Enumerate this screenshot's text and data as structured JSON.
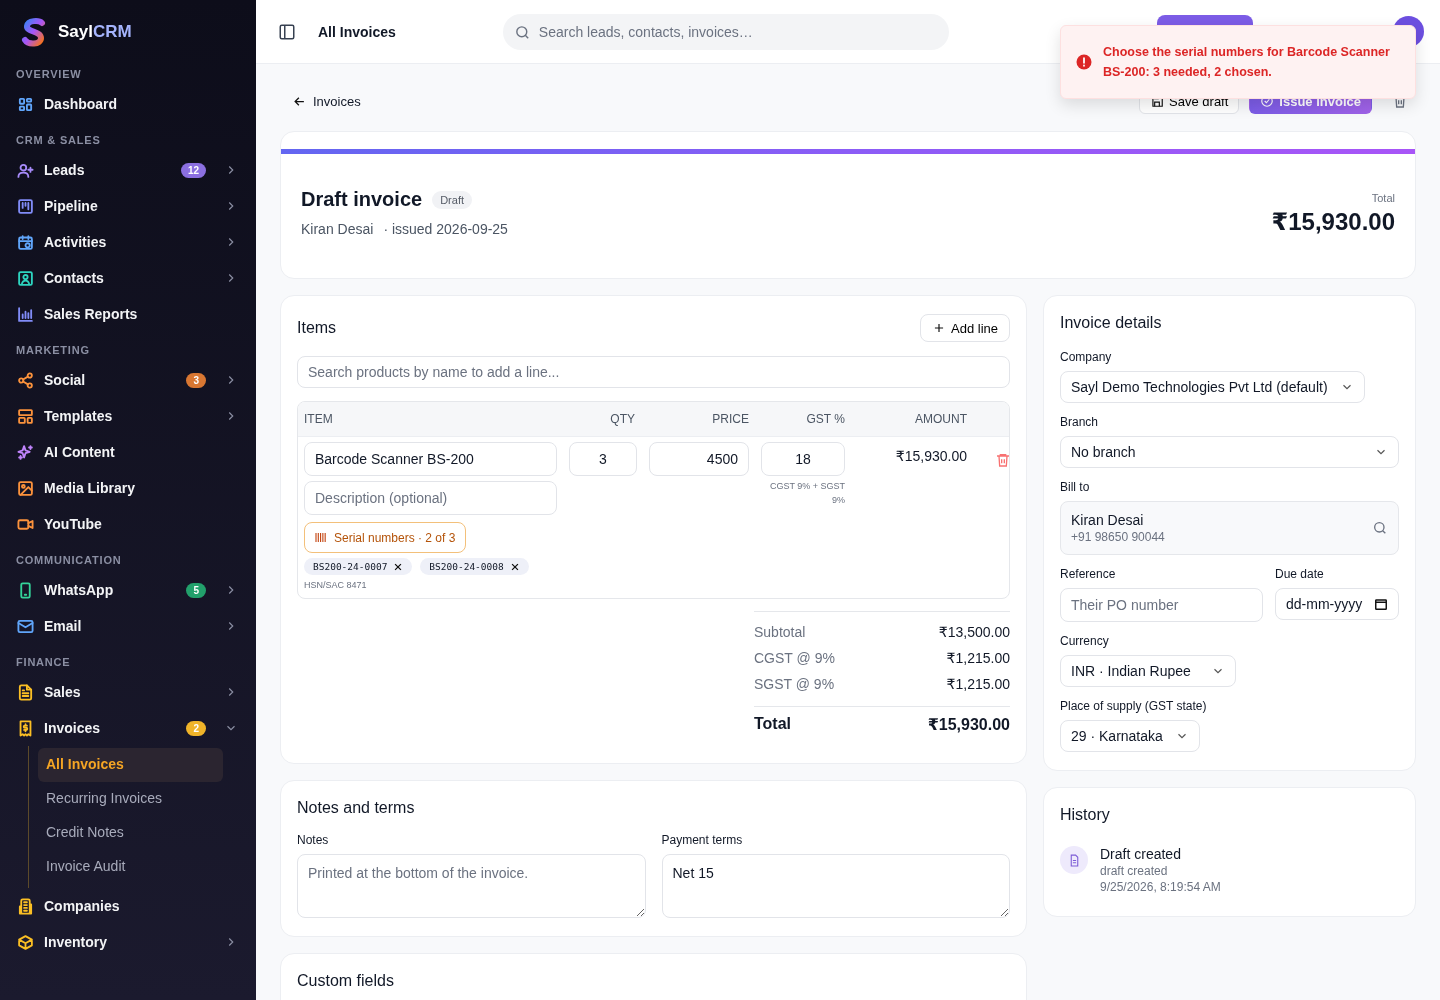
{
  "sidebar": {
    "brand": {
      "first": "Sayl",
      "second": "CRM"
    },
    "sections": [
      {
        "title": "OVERVIEW",
        "items": [
          {
            "label": "Dashboard",
            "color": "#60a5fa",
            "expandable": false
          }
        ]
      },
      {
        "title": "CRM & SALES",
        "items": [
          {
            "label": "Leads",
            "color": "#a78bfa",
            "badge": {
              "text": "12",
              "color": "#8b6fe0"
            },
            "expandable": true,
            "expanded": false
          },
          {
            "label": "Pipeline",
            "color": "#818cf8",
            "expandable": true,
            "expanded": false
          },
          {
            "label": "Activities",
            "color": "#60a5fa",
            "expandable": true,
            "expanded": false
          },
          {
            "label": "Contacts",
            "color": "#2dd4bf",
            "expandable": true,
            "expanded": false
          },
          {
            "label": "Sales Reports",
            "color": "#818cf8",
            "expandable": false
          }
        ]
      },
      {
        "title": "MARKETING",
        "items": [
          {
            "label": "Social",
            "color": "#fb923c",
            "badge": {
              "text": "3",
              "color": "#d97732"
            },
            "expandable": true,
            "expanded": false
          },
          {
            "label": "Templates",
            "color": "#fb923c",
            "expandable": true,
            "expanded": false
          },
          {
            "label": "AI Content",
            "color": "#c084fc",
            "expandable": false
          },
          {
            "label": "Media Library",
            "color": "#fb923c",
            "expandable": false
          },
          {
            "label": "YouTube",
            "color": "#fb923c",
            "expandable": false
          }
        ]
      },
      {
        "title": "COMMUNICATION",
        "items": [
          {
            "label": "WhatsApp",
            "color": "#34d399",
            "badge": {
              "text": "5",
              "color": "#22a06b"
            },
            "expandable": true,
            "expanded": false
          },
          {
            "label": "Email",
            "color": "#60a5fa",
            "expandable": true,
            "expanded": false
          }
        ]
      },
      {
        "title": "FINANCE",
        "items": [
          {
            "label": "Sales",
            "color": "#fbbf24",
            "expandable": true,
            "expanded": false
          },
          {
            "label": "Invoices",
            "color": "#fbbf24",
            "badge": {
              "text": "2",
              "color": "#f0b429"
            },
            "expandable": true,
            "expanded": true,
            "children": [
              {
                "label": "All Invoices",
                "selected": true
              },
              {
                "label": "Recurring Invoices",
                "selected": false
              },
              {
                "label": "Credit Notes",
                "selected": false
              },
              {
                "label": "Invoice Audit",
                "selected": false
              }
            ]
          },
          {
            "label": "Companies",
            "color": "#fbbf24",
            "expandable": false
          },
          {
            "label": "Inventory",
            "color": "#fbbf24",
            "expandable": true,
            "expanded": false
          }
        ]
      }
    ]
  },
  "topbar": {
    "title": "All Invoices",
    "search": {
      "placeholder": "Search leads, contacts, invoices…"
    }
  },
  "toast": {
    "message": "Choose the serial numbers for Barcode Scanner BS-200: 3 needed, 2 chosen."
  },
  "toolbar": {
    "back": "Invoices",
    "buttons": [
      {
        "label": "Save draft",
        "kind": "outline"
      },
      {
        "label": "Issue invoice",
        "kind": "primary"
      }
    ]
  },
  "header": {
    "title": "Draft invoice",
    "status": "Draft",
    "customer": "Kiran Desai",
    "issued": "· issued 2026-09-25",
    "total_label": "Total",
    "total": "₹15,930.00"
  },
  "items": {
    "title": "Items",
    "add_label": "Add line",
    "search": {
      "placeholder": "Search products by name to add a line..."
    },
    "columns": [
      "ITEM",
      "QTY",
      "PRICE",
      "GST %",
      "AMOUNT"
    ],
    "lines": [
      {
        "name": "Barcode Scanner BS-200",
        "description": {
          "placeholder": "Description (optional)"
        },
        "qty": "3",
        "price": "4500",
        "gst": "18",
        "gst_note": "CGST 9% + SGST 9%",
        "amount": "₹15,930.00",
        "serial_button": "Serial numbers · 2 of 3",
        "serials": [
          "BS200-24-0007",
          "BS200-24-0008"
        ],
        "hsn": "HSN/SAC 8471"
      }
    ],
    "totals": [
      {
        "label": "Subtotal",
        "value": "₹13,500.00",
        "kind": "line"
      },
      {
        "label": "CGST @ 9%",
        "value": "₹1,215.00",
        "kind": "line"
      },
      {
        "label": "SGST @ 9%",
        "value": "₹1,215.00",
        "kind": "line"
      },
      {
        "label": "Total",
        "value": "₹15,930.00",
        "kind": "grand"
      }
    ]
  },
  "details": {
    "title": "Invoice details",
    "company": {
      "label": "Company",
      "value": "Sayl Demo Technologies Pvt Ltd (default)"
    },
    "branch": {
      "label": "Branch",
      "value": "No branch"
    },
    "bill_to": {
      "label": "Bill to",
      "name": "Kiran Desai",
      "phone": "+91 98650 90044"
    },
    "reference": {
      "label": "Reference",
      "placeholder": "Their PO number"
    },
    "due_date": {
      "label": "Due date",
      "value": "dd-mm-yyyy"
    },
    "currency": {
      "label": "Currency",
      "value": "INR · Indian Rupee"
    },
    "place_of_supply": {
      "label": "Place of supply (GST state)",
      "value": "29 · Karnataka"
    }
  },
  "notes": {
    "title": "Notes and terms",
    "notes": {
      "label": "Notes",
      "placeholder": "Printed at the bottom of the invoice."
    },
    "terms": {
      "label": "Payment terms",
      "value": "Net 15"
    }
  },
  "history": {
    "title": "History",
    "events": [
      {
        "title": "Draft created",
        "detail": "draft created",
        "time": "9/25/2026, 8:19:54 AM"
      }
    ]
  },
  "custom_fields": {
    "title": "Custom fields"
  }
}
